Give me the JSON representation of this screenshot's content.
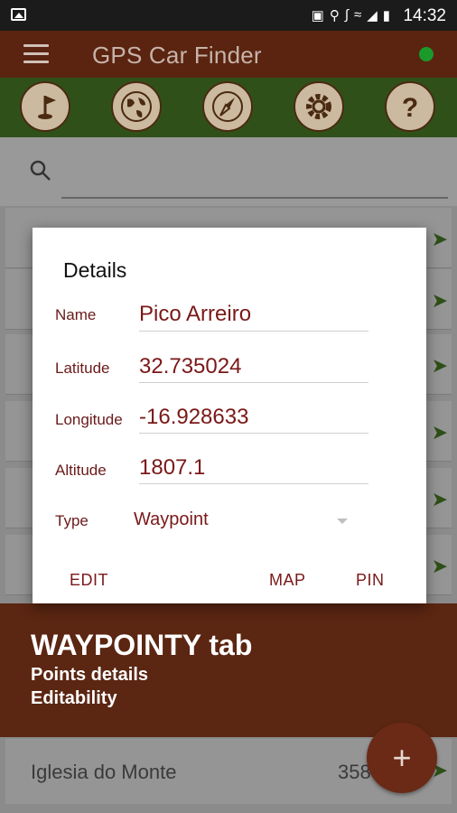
{
  "status_bar": {
    "time": "14:32",
    "icons": [
      "image-icon",
      "lock-icon",
      "location-pin-icon",
      "bluetooth-icon",
      "wifi-icon",
      "signal-icon",
      "battery-icon"
    ]
  },
  "app_bar": {
    "title": "GPS Car Finder",
    "gps_status_color": "#1a9a2a"
  },
  "toolbar": {
    "buttons": [
      "flag-icon",
      "globe-icon",
      "compass-icon",
      "gear-icon",
      "help-icon"
    ]
  },
  "list": {
    "bottom_item": {
      "name": "Iglesia do Monte",
      "distance": "358"
    }
  },
  "dialog": {
    "title": "Details",
    "fields": {
      "name": {
        "label": "Name",
        "value": "Pico Arreiro"
      },
      "latitude": {
        "label": "Latitude",
        "value": "32.735024"
      },
      "longitude": {
        "label": "Longitude",
        "value": "-16.928633"
      },
      "altitude": {
        "label": "Altitude",
        "value": "1807.1"
      }
    },
    "type": {
      "label": "Type",
      "value": "Waypoint"
    },
    "buttons": {
      "edit": "EDIT",
      "map": "MAP",
      "pin": "PIN"
    }
  },
  "banner": {
    "title": "WAYPOINTY tab",
    "line1": "Points details",
    "line2": "Editability"
  },
  "fab": {
    "label": "+"
  },
  "colors": {
    "app_bar": "#5a2410",
    "toolbar": "#2f5119",
    "accent_text": "#7a1818",
    "banner": "#5b2612"
  }
}
